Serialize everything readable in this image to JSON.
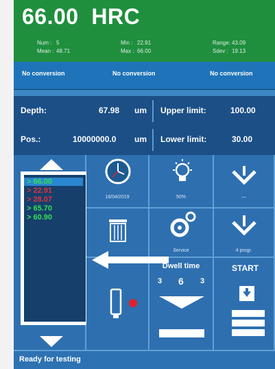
{
  "header": {
    "value": "66.00",
    "unit": "HRC",
    "num_label": "Num :",
    "num": "5",
    "mean_label": "Mean :",
    "mean": "48.71",
    "min_label": "Min :",
    "min": "22.91",
    "max_label": "Max :",
    "max": "66.00",
    "range_label": "Range:",
    "range": "43.09",
    "sdev_label": "Sdev :",
    "sdev": "19.13"
  },
  "conversions": [
    "No conversion",
    "No conversion",
    "No conversion"
  ],
  "info": {
    "depth_label": "Depth:",
    "depth_value": "67.98",
    "depth_unit": "um",
    "upper_label": "Upper limit:",
    "upper_value": "100.00",
    "pos_label": "Pos.:",
    "pos_value": "10000000.0",
    "pos_unit": "um",
    "lower_label": "Lower limit:",
    "lower_value": "30.00"
  },
  "values_list": [
    {
      "text": "> 66.00",
      "color": "#34e053",
      "selected": true
    },
    {
      "text": "> 22.91",
      "color": "#e0343c",
      "selected": false
    },
    {
      "text": "> 28.07",
      "color": "#e0343c",
      "selected": false
    },
    {
      "text": "> 65.70",
      "color": "#34e053",
      "selected": false
    },
    {
      "text": "> 60.90",
      "color": "#34e053",
      "selected": false
    }
  ],
  "tiles": {
    "date": "16/04/2019",
    "brightness": "50%",
    "brightness_btn": "—",
    "service": "Service",
    "program": "4 progr."
  },
  "dwell": {
    "title": "Dwell time",
    "values": [
      "3",
      "6",
      "3"
    ]
  },
  "start_label": "START",
  "status": "Ready for testing",
  "colors": {
    "header_green": "#1f8f3e",
    "panel_blue": "#2e6fb0",
    "record_red": "#e0202a"
  }
}
